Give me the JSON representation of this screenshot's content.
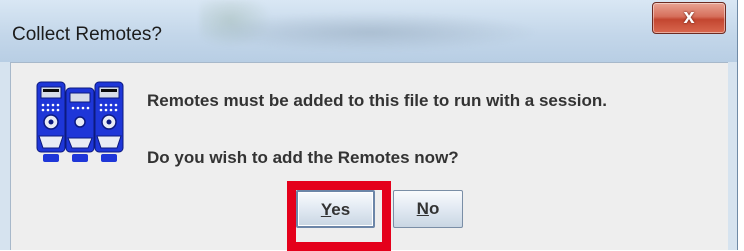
{
  "dialog": {
    "title": "Collect Remotes?",
    "close_label": "x",
    "message_line1": "Remotes must be added to this file to run with a session.",
    "message_line2": "Do you wish to add the Remotes now?",
    "icon": "remotes-icon"
  },
  "buttons": {
    "yes_mnemonic": "Y",
    "yes_rest": "es",
    "no_mnemonic": "N",
    "no_rest": "o"
  },
  "colors": {
    "highlight": "#e4001b",
    "icon_blue": "#1e36d8"
  }
}
